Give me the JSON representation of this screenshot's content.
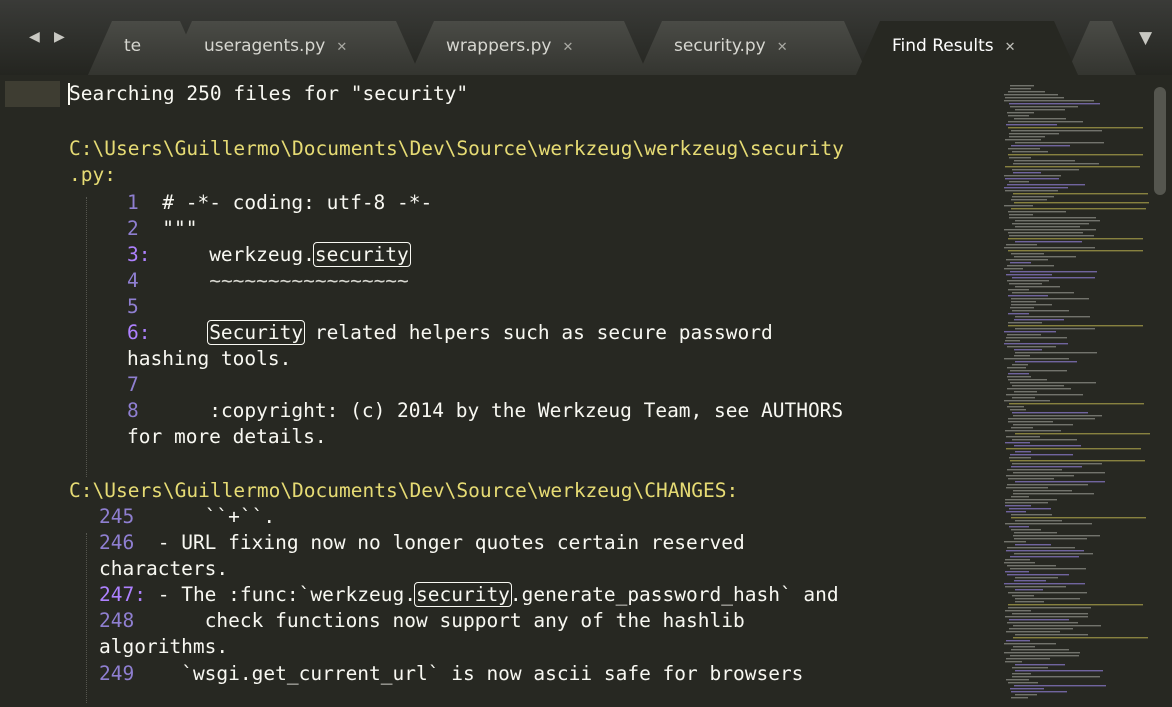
{
  "tabs": {
    "nav_left": "◀",
    "nav_right": "▶",
    "items": [
      {
        "label": "te",
        "close": ""
      },
      {
        "label": "useragents.py",
        "close": "✕"
      },
      {
        "label": "wrappers.py",
        "close": "✕"
      },
      {
        "label": "security.py",
        "close": "✕"
      },
      {
        "label": "Find Results",
        "close": "✕"
      }
    ],
    "overflow": "▼"
  },
  "results": {
    "header": "Searching 250 files for \"security\"",
    "file1": {
      "path": "C:\\Users\\Guillermo\\Documents\\Dev\\Source\\werkzeug\\werkzeug\\security",
      "path_cont": ".py:",
      "lines": [
        {
          "num": "1",
          "text": "# -*- coding: utf-8 -*-"
        },
        {
          "num": "2",
          "text": "\"\"\""
        },
        {
          "num": "3:",
          "pre": "werkzeug.",
          "match": "security",
          "post": ""
        },
        {
          "num": "4",
          "text": "~~~~~~~~~~~~~~~~~"
        },
        {
          "num": "5",
          "text": ""
        },
        {
          "num": "6:",
          "pre": "",
          "match": "Security",
          "post": " related helpers such as secure password",
          "cont": "hashing tools."
        },
        {
          "num": "7",
          "text": ""
        },
        {
          "num": "8",
          "text": ":copyright: (c) 2014 by the Werkzeug Team, see AUTHORS",
          "cont": "for more details."
        }
      ]
    },
    "file2": {
      "path": "C:\\Users\\Guillermo\\Documents\\Dev\\Source\\werkzeug\\CHANGES:",
      "lines": [
        {
          "num": "245",
          "text": "``+``."
        },
        {
          "num": "246",
          "text": "- URL fixing now no longer quotes certain reserved",
          "cont": "characters."
        },
        {
          "num": "247:",
          "pre": "- The :func:`werkzeug.",
          "match": "security",
          "post": ".generate_password_hash` and"
        },
        {
          "num": "248",
          "text": "check functions now support any of the hashlib",
          "cont": "algorithms."
        },
        {
          "num": "249",
          "text": "`wsgi.get_current_url` is now ascii safe for browsers"
        }
      ]
    }
  },
  "colors": {
    "background": "#272822",
    "path": "#e6db74",
    "line_number": "#ae81ff",
    "text": "#f8f8f2"
  }
}
